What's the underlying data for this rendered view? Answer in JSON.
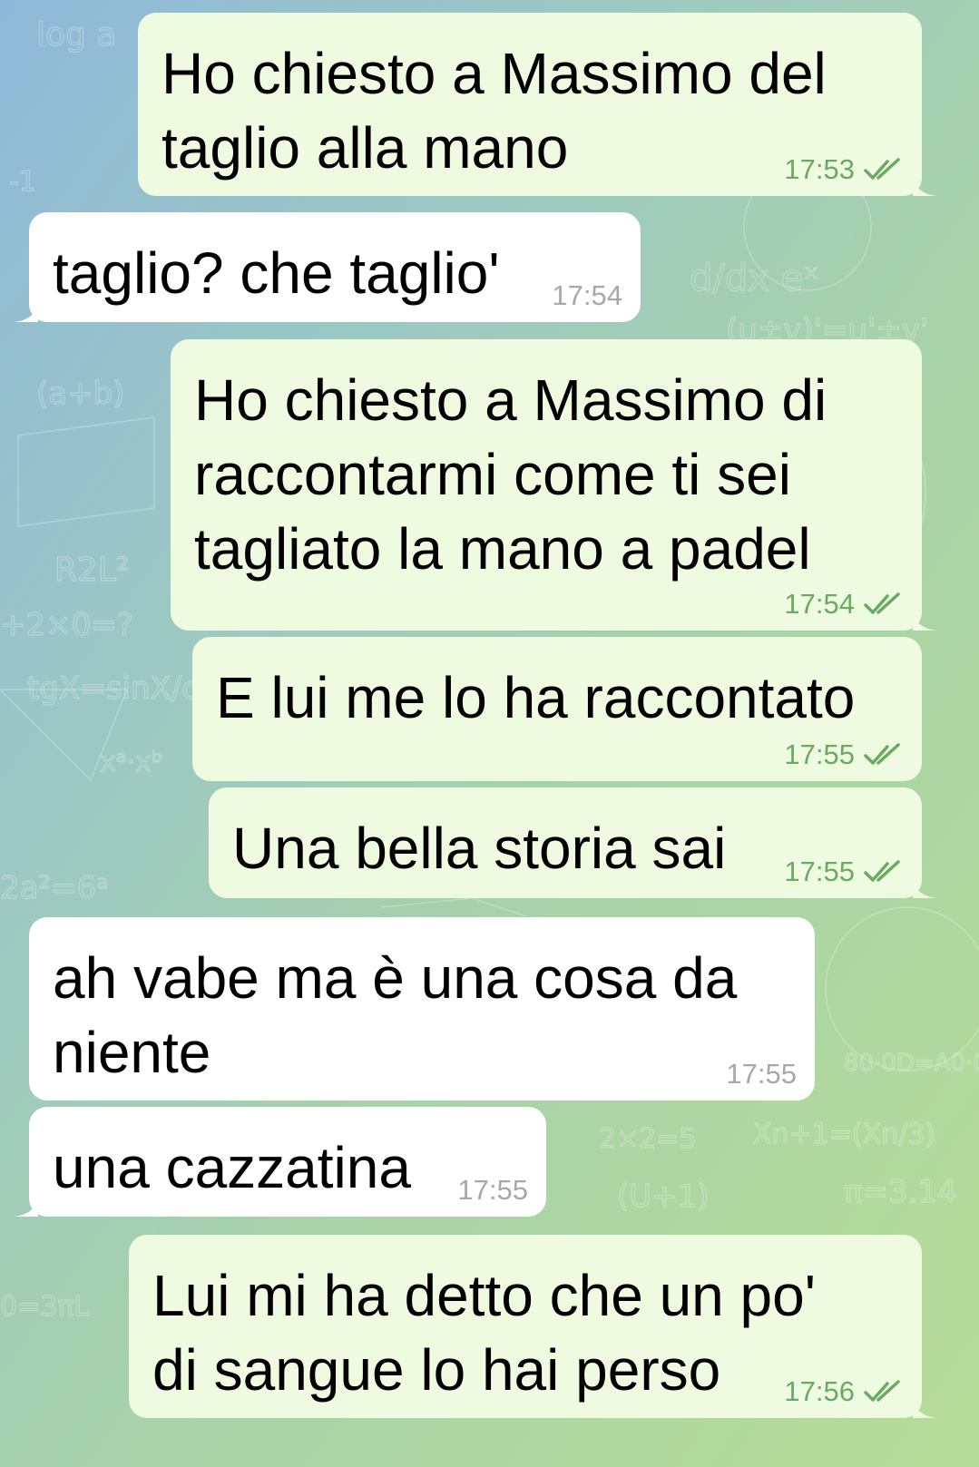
{
  "messages": [
    {
      "direction": "out",
      "text": "Ho chiesto a Massimo del\ntaglio alla mano",
      "time": "17:53",
      "status": "read"
    },
    {
      "direction": "in",
      "text": "taglio? che taglio'",
      "time": "17:54"
    },
    {
      "direction": "out",
      "text": "Ho chiesto a Massimo di\nraccontarmi come ti sei\ntagliato la mano a padel",
      "time": "17:54",
      "status": "read"
    },
    {
      "direction": "out",
      "text": "E lui me lo ha raccontato",
      "time": "17:55",
      "status": "read"
    },
    {
      "direction": "out",
      "text": "Una bella storia sai",
      "time": "17:55",
      "status": "read"
    },
    {
      "direction": "in",
      "text": "ah vabe ma è una cosa da\nniente",
      "time": "17:55"
    },
    {
      "direction": "in",
      "text": "una cazzatina",
      "time": "17:55"
    },
    {
      "direction": "out",
      "text": "Lui mi ha detto che un po'\ndi sangue lo hai perso",
      "time": "17:56",
      "status": "read"
    }
  ],
  "colors": {
    "outgoing_bubble": "#eefbe0",
    "incoming_bubble": "#ffffff",
    "outgoing_meta": "#6ba965",
    "incoming_meta": "#a8a8a8"
  },
  "icons": {
    "read_status": "double-check-icon"
  }
}
